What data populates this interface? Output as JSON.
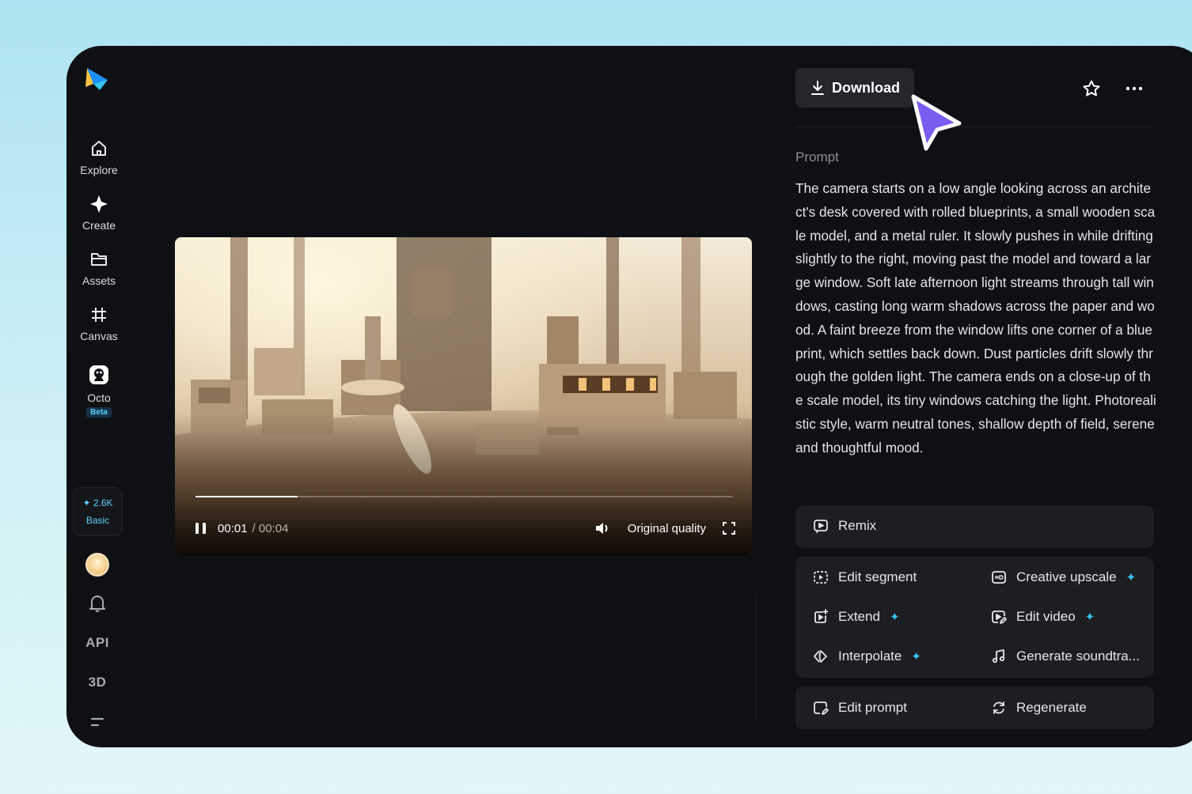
{
  "sidebar": {
    "items": [
      {
        "label": "Explore",
        "icon": "home-icon"
      },
      {
        "label": "Create",
        "icon": "sparkle-icon"
      },
      {
        "label": "Assets",
        "icon": "folder-icon"
      },
      {
        "label": "Canvas",
        "icon": "crop-icon"
      },
      {
        "label": "Octo",
        "icon": "octo-icon",
        "badge": "Beta"
      }
    ],
    "credits": {
      "amount": "2.6K",
      "plan": "Basic"
    },
    "api_label": "API",
    "threed_label": "3D"
  },
  "video": {
    "current_time": "00:01",
    "total_time": "/ 00:04",
    "progress": 0.19,
    "quality": "Original quality"
  },
  "panel": {
    "download_label": "Download",
    "prompt_label": "Prompt",
    "prompt_text": "The camera starts on a low angle looking across an architect's desk covered with rolled blueprints, a small wooden scale model, and a metal ruler. It slowly pushes in while drifting slightly to the right, moving past the model and toward a large window. Soft late afternoon light streams through tall windows, casting long warm shadows across the paper and wood. A faint breeze from the window lifts one corner of a blueprint, which settles back down. Dust particles drift slowly through the golden light. The camera ends on a close-up of the scale model, its tiny windows catching the light. Photorealistic style, warm neutral tones, shallow depth of field, serene and thoughtful mood.",
    "remix_label": "Remix",
    "edit_segment_label": "Edit segment",
    "creative_upscale_label": "Creative upscale",
    "extend_label": "Extend",
    "edit_video_label": "Edit video",
    "interpolate_label": "Interpolate",
    "generate_soundtrack_label": "Generate soundtra...",
    "edit_prompt_label": "Edit prompt",
    "regenerate_label": "Regenerate",
    "accent_color": "#38c6f4"
  }
}
